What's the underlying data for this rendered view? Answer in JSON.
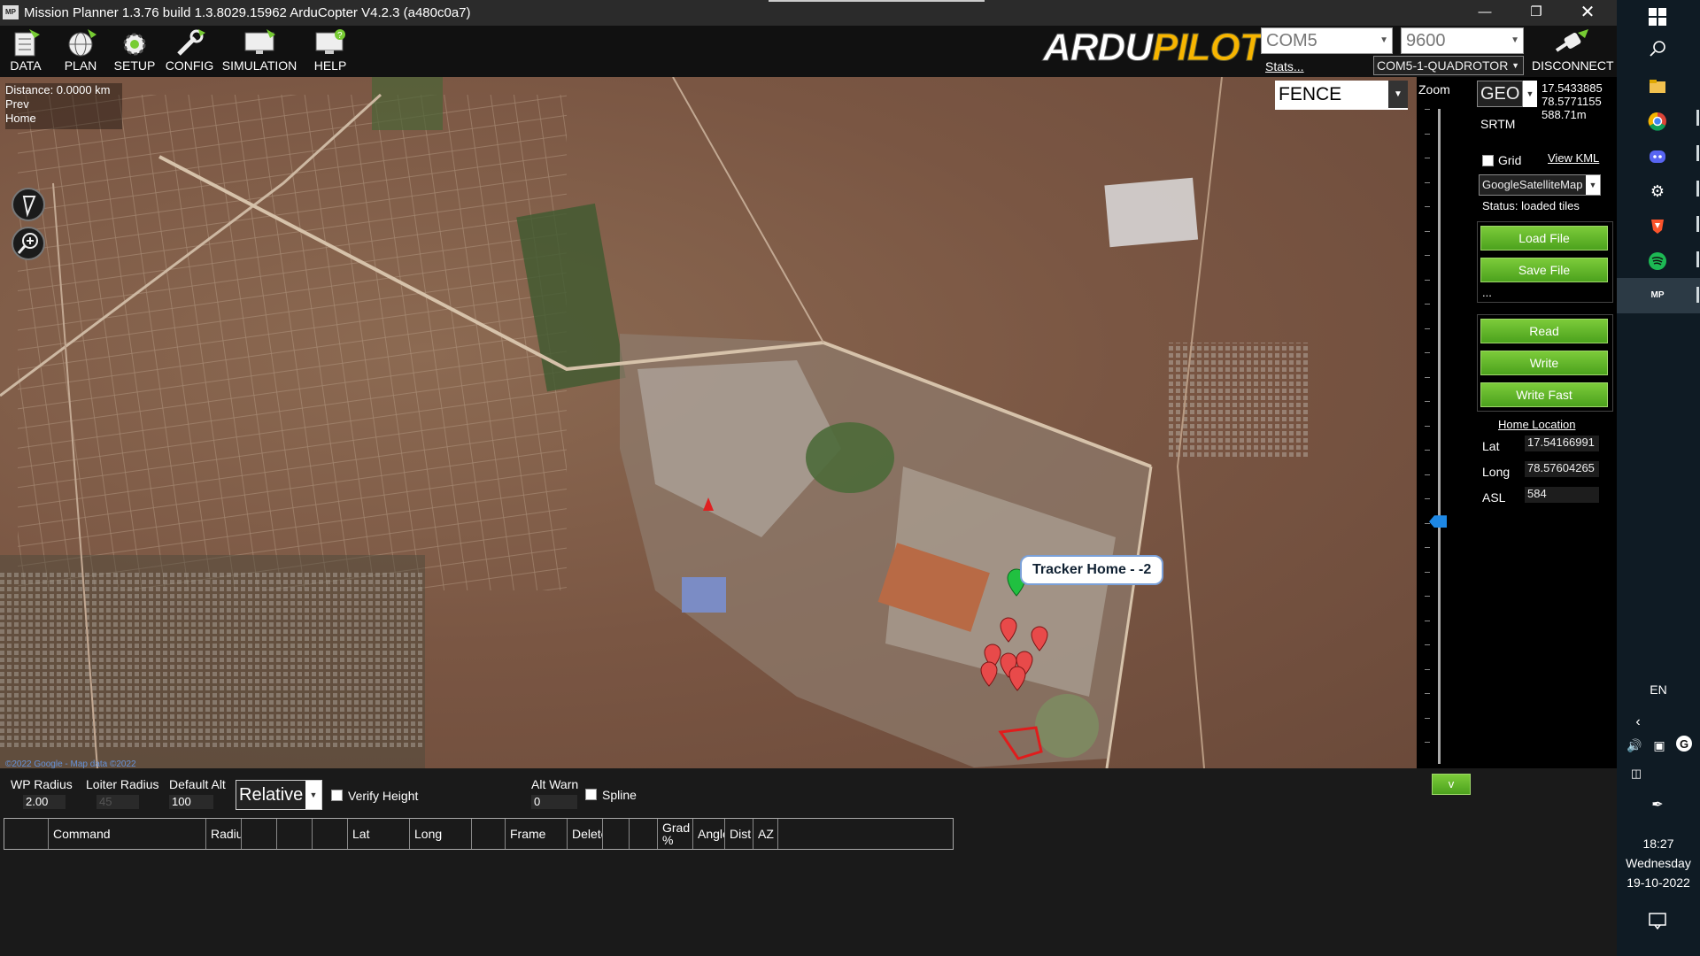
{
  "window": {
    "title": "Mission Planner 1.3.76 build 1.3.8029.15962 ArduCopter V4.2.3 (a480c0a7)",
    "icon_text": "MP",
    "controls": [
      "minimize-icon",
      "maximize-icon",
      "close-icon"
    ]
  },
  "toolbar": {
    "buttons": [
      {
        "label": "DATA",
        "icon": "data-icon"
      },
      {
        "label": "PLAN",
        "icon": "globe-icon"
      },
      {
        "label": "SETUP",
        "icon": "setup-icon"
      },
      {
        "label": "CONFIG",
        "icon": "config-icon"
      },
      {
        "label": "SIMULATION",
        "icon": "simulation-icon"
      },
      {
        "label": "HELP",
        "icon": "help-icon"
      }
    ],
    "logo_part1": "ARDU",
    "logo_part2": "PILOT",
    "port": "COM5",
    "baud": "9600",
    "stats_link": "Stats...",
    "vehicle": "COM5-1-QUADROTOR",
    "disconnect_label": "DISCONNECT"
  },
  "map": {
    "info": {
      "distance": "Distance: 0.0000 km",
      "prev": "Prev",
      "home": "Home"
    },
    "layer_select": "FENCE",
    "zoom_label": "Zoom",
    "zoom_level_fraction": 0.37,
    "tracker_label": "Tracker Home - -2",
    "attribution": "©2022 Google - Map data ©2022"
  },
  "right_panel": {
    "coord_system": "GEO",
    "lat": "17.5433885",
    "lng": "78.5771155",
    "alt": "588.71m",
    "srtm": "SRTM",
    "grid_label": "Grid",
    "view_kml": "View KML",
    "map_provider": "GoogleSatelliteMap",
    "status": "Status: loaded tiles",
    "load_file": "Load File",
    "save_file": "Save File",
    "ellipsis": "...",
    "read": "Read",
    "write": "Write",
    "write_fast": "Write Fast",
    "home_location": "Home Location",
    "home": {
      "lat_label": "Lat",
      "lat_value": "17.54166991",
      "long_label": "Long",
      "long_value": "78.57604265",
      "asl_label": "ASL",
      "asl_value": "584"
    },
    "collapse_button": "v"
  },
  "bottom": {
    "wp_radius_label": "WP Radius",
    "wp_radius": "2.00",
    "loiter_radius_label": "Loiter Radius",
    "loiter_radius": "45",
    "default_alt_label": "Default Alt",
    "default_alt": "100",
    "alt_frame": "Relative",
    "verify_height": "Verify Height",
    "alt_warn_label": "Alt Warn",
    "alt_warn": "0",
    "spline": "Spline",
    "columns": [
      "",
      "Command",
      "Radius",
      "",
      "",
      "",
      "Lat",
      "Long",
      "",
      "Frame",
      "Delete",
      "",
      "",
      "Grad %",
      "Angle",
      "Dist",
      "AZ"
    ]
  },
  "taskbar": {
    "lang": "EN",
    "time": "18:27",
    "day": "Wednesday",
    "date": "19-10-2022"
  }
}
